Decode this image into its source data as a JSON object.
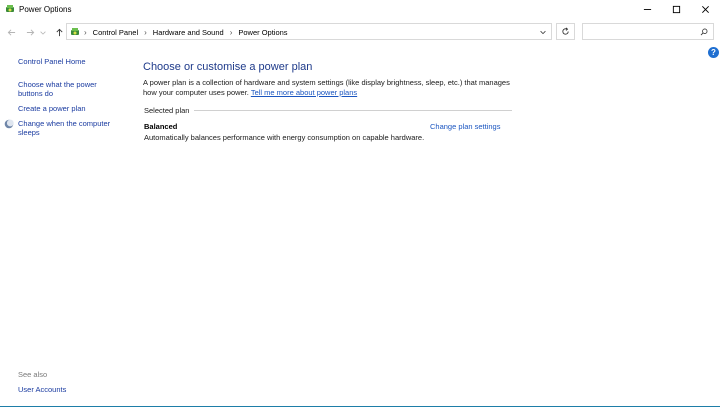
{
  "window": {
    "title": "Power Options",
    "controls": [
      "minimize",
      "maximize",
      "close"
    ]
  },
  "navigation": {
    "breadcrumbs": [
      "Control Panel",
      "Hardware and Sound",
      "Power Options"
    ],
    "search": {
      "placeholder": "",
      "value": ""
    }
  },
  "sidebar": {
    "home": "Control Panel Home",
    "links": [
      {
        "line1": "Choose what the power",
        "line2": "buttons do"
      },
      {
        "line1": "Create a power plan"
      },
      {
        "line1": "Change when the computer",
        "line2": "sleeps"
      }
    ],
    "see_also_heading": "See also",
    "see_also_link": "User Accounts"
  },
  "main": {
    "heading": "Choose or customise a power plan",
    "description_line1": "A power plan is a collection of hardware and system settings (like display brightness, sleep, etc.) that manages",
    "description_line2": "how your computer uses power.",
    "learn_more": "Tell me more about power plans",
    "selected_plan_label": "Selected plan",
    "plan": {
      "name": "Balanced",
      "change_link": "Change plan settings",
      "description": "Automatically balances performance with energy consumption on capable hardware."
    }
  },
  "help": {
    "label": "?"
  },
  "colors": {
    "link": "#1a3ba0",
    "heading": "#1e3a8a",
    "help": "#1f6fd1"
  }
}
